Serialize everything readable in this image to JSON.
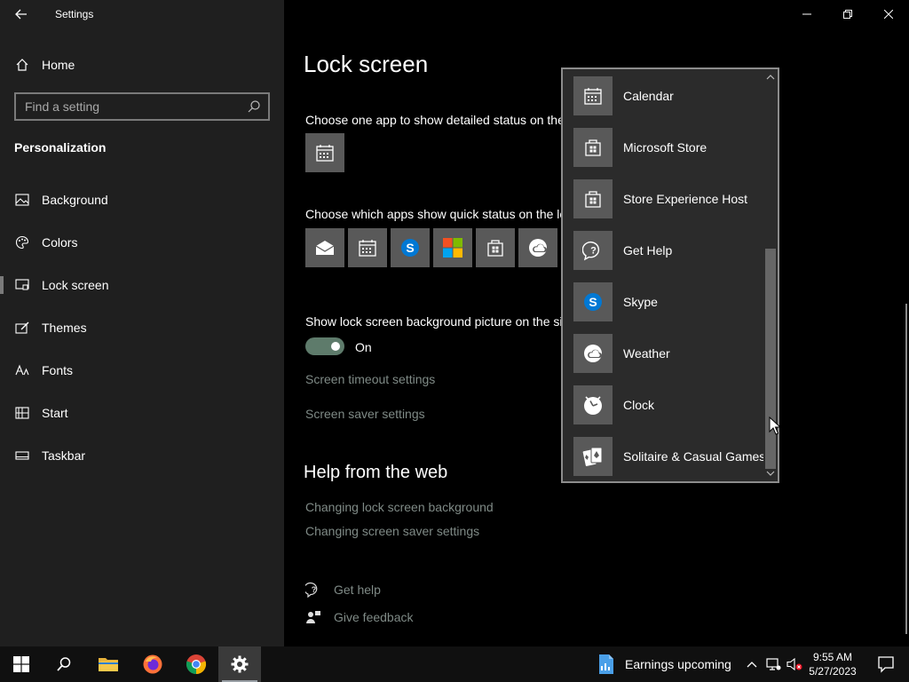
{
  "window": {
    "title": "Settings"
  },
  "sidebar": {
    "home_label": "Home",
    "search_placeholder": "Find a setting",
    "section": "Personalization",
    "items": [
      {
        "label": "Background",
        "icon": "image-icon"
      },
      {
        "label": "Colors",
        "icon": "palette-icon"
      },
      {
        "label": "Lock screen",
        "icon": "lock-screen-icon",
        "selected": true
      },
      {
        "label": "Themes",
        "icon": "brush-icon"
      },
      {
        "label": "Fonts",
        "icon": "font-icon"
      },
      {
        "label": "Start",
        "icon": "start-grid-icon"
      },
      {
        "label": "Taskbar",
        "icon": "taskbar-icon"
      }
    ]
  },
  "main": {
    "title": "Lock screen",
    "detailed_status_label": "Choose one app to show detailed status on the",
    "quick_status_label": "Choose which apps show quick status on the lo",
    "quick_apps": [
      "mail-icon",
      "calendar-icon",
      "skype-icon",
      "microsoft-store-logo-icon",
      "store-bag-icon",
      "weather-icon"
    ],
    "bg_picture_label": "Show lock screen background picture on the si",
    "toggle_state": "On",
    "links": {
      "screen_timeout": "Screen timeout settings",
      "screen_saver": "Screen saver settings"
    },
    "help": {
      "heading": "Help from the web",
      "link1": "Changing lock screen background",
      "link2": "Changing screen saver settings"
    },
    "get_help": "Get help",
    "give_feedback": "Give feedback"
  },
  "dropdown": {
    "items": [
      {
        "label": "Calendar",
        "icon": "calendar-icon"
      },
      {
        "label": "Microsoft Store",
        "icon": "store-bag-icon"
      },
      {
        "label": "Store Experience Host",
        "icon": "store-bag-icon"
      },
      {
        "label": "Get Help",
        "icon": "get-help-icon"
      },
      {
        "label": "Skype",
        "icon": "skype-icon"
      },
      {
        "label": "Weather",
        "icon": "weather-icon"
      },
      {
        "label": "Clock",
        "icon": "clock-icon"
      },
      {
        "label": "Solitaire & Casual Games",
        "icon": "cards-icon"
      }
    ]
  },
  "taskbar": {
    "widget_label": "Earnings upcoming",
    "time": "9:55 AM",
    "date": "5/27/2023"
  },
  "colors": {
    "toggle_on": "#5e7b6b",
    "tile": "#595959",
    "link": "#7f8a86",
    "skype": "#0078d4"
  }
}
